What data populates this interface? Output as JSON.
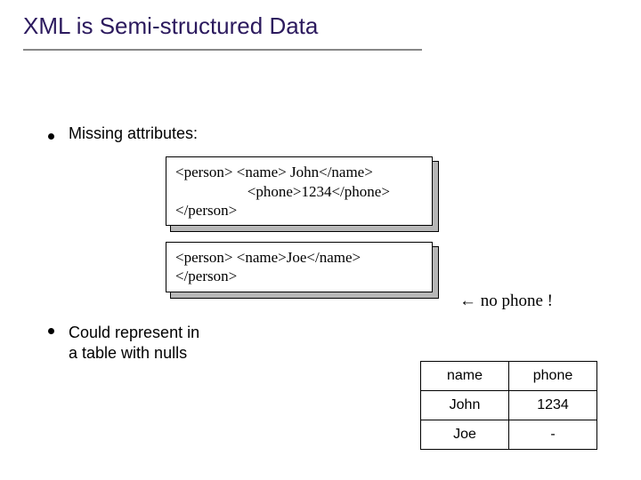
{
  "title": "XML is Semi-structured Data",
  "bullets": {
    "b1": "Missing attributes:",
    "b2": "Could represent in\na table with nulls"
  },
  "code": {
    "l1": "<person>   <name> John</name>",
    "l2": "                   <phone>1234</phone>",
    "l3": "</person>",
    "l4": "",
    "l5": "<person>  <name>Joe</name>",
    "l6": "</person>"
  },
  "annotation": {
    "arrow": "←",
    "text": " no phone !"
  },
  "table": {
    "headers": {
      "c1": "name",
      "c2": "phone"
    },
    "rows": [
      {
        "c1": "John",
        "c2": "1234"
      },
      {
        "c1": "Joe",
        "c2": "-"
      }
    ]
  },
  "chart_data": {
    "type": "table",
    "columns": [
      "name",
      "phone"
    ],
    "rows": [
      [
        "John",
        "1234"
      ],
      [
        "Joe",
        "-"
      ]
    ]
  }
}
